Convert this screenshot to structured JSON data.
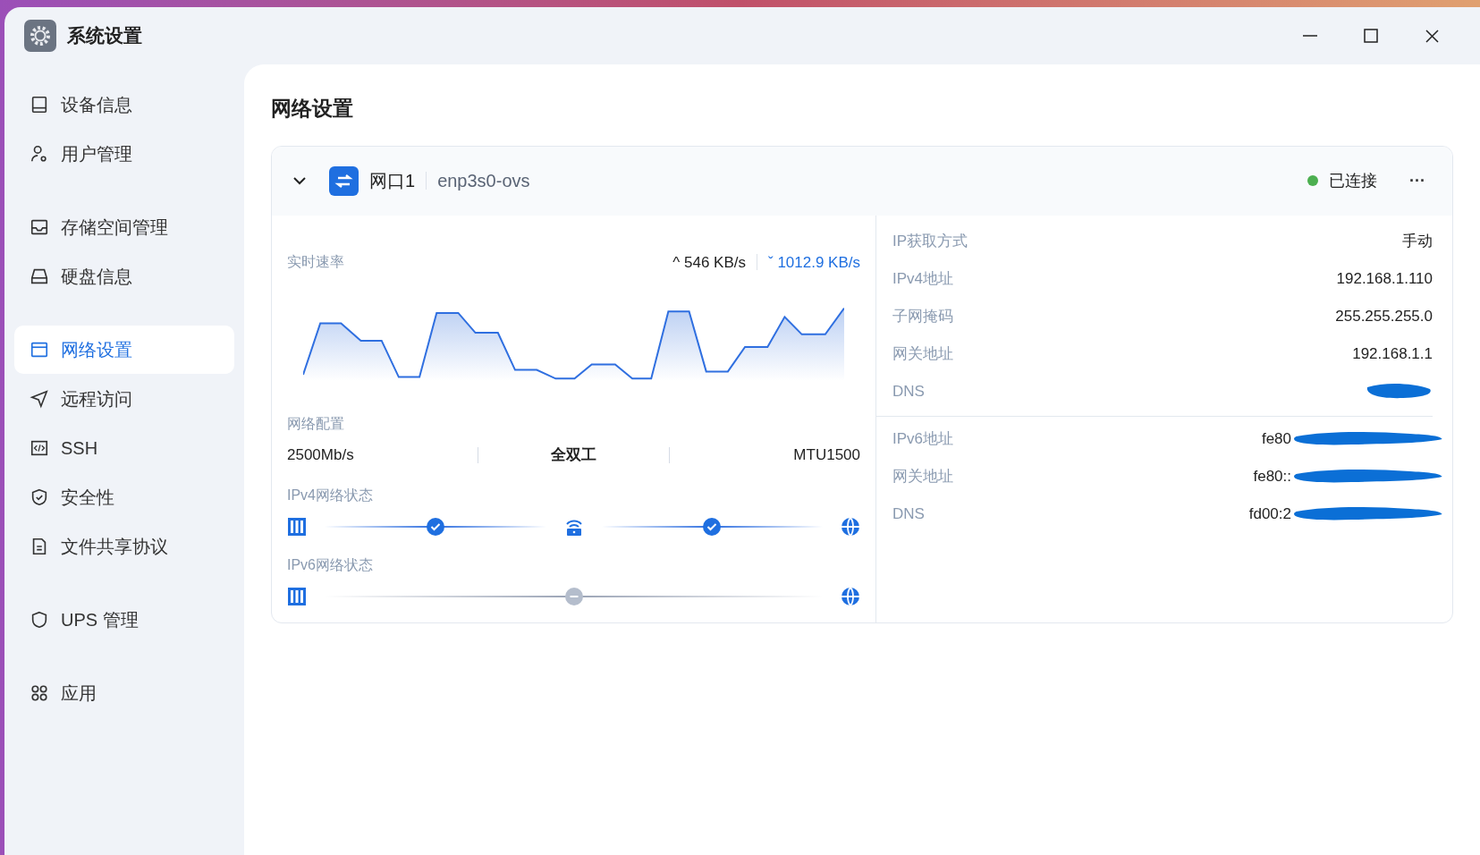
{
  "window": {
    "title": "系统设置"
  },
  "sidebar": {
    "groups": [
      {
        "items": [
          {
            "label": "设备信息",
            "selected": false
          },
          {
            "label": "用户管理",
            "selected": false
          }
        ]
      },
      {
        "items": [
          {
            "label": "存储空间管理",
            "selected": false
          },
          {
            "label": "硬盘信息",
            "selected": false
          }
        ]
      },
      {
        "items": [
          {
            "label": "网络设置",
            "selected": true
          },
          {
            "label": "远程访问",
            "selected": false
          },
          {
            "label": "SSH",
            "selected": false
          },
          {
            "label": "安全性",
            "selected": false
          },
          {
            "label": "文件共享协议",
            "selected": false
          }
        ]
      },
      {
        "items": [
          {
            "label": "UPS 管理",
            "selected": false
          }
        ]
      },
      {
        "items": [
          {
            "label": "应用",
            "selected": false
          }
        ]
      }
    ]
  },
  "page_title": "网络设置",
  "interface": {
    "expanded": true,
    "name": "网口1",
    "device": "enp3s0-ovs",
    "status": {
      "label": "已连接",
      "color": "#4caf50"
    },
    "more": "···",
    "speed": {
      "label": "实时速率",
      "up_icon": "^",
      "up": "546 KB/s",
      "down_icon": "ˇ",
      "down": "1012.9 KB/s"
    },
    "config": {
      "label": "网络配置",
      "values": [
        "2500Mb/s",
        "全双工",
        "MTU1500"
      ]
    },
    "ipv4_status": {
      "label": "IPv4网络状态",
      "links": [
        {
          "connected": true
        },
        {
          "connected": true
        }
      ]
    },
    "ipv6_status": {
      "label": "IPv6网络状态",
      "links": [
        {
          "connected": false
        }
      ]
    },
    "ipv4_info": [
      {
        "label": "IP获取方式",
        "value": "手动",
        "redacted": false
      },
      {
        "label": "IPv4地址",
        "value": "192.168.1.110",
        "redacted": false
      },
      {
        "label": "子网掩码",
        "value": "255.255.255.0",
        "redacted": false
      },
      {
        "label": "网关地址",
        "value": "192.168.1.1",
        "redacted": false
      },
      {
        "label": "DNS",
        "redacted": true
      }
    ],
    "ipv6_info": [
      {
        "label": "IPv6地址",
        "value": "fe80",
        "redacted": true
      },
      {
        "label": "网关地址",
        "value": "fe80::",
        "redacted": true
      },
      {
        "label": "DNS",
        "value": "fd00:2",
        "redacted": true
      }
    ]
  }
}
